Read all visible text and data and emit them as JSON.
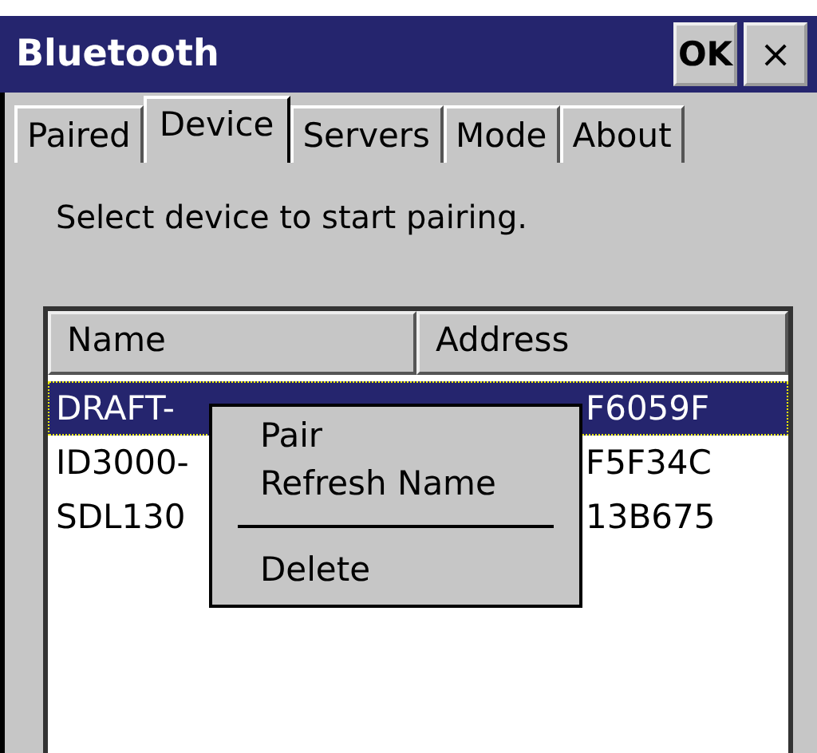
{
  "window": {
    "title": "Bluetooth",
    "ok_button": "OK",
    "close_button": "×"
  },
  "tabs": [
    {
      "label": "Paired",
      "selected": false
    },
    {
      "label": "Device",
      "selected": true
    },
    {
      "label": "Servers",
      "selected": false
    },
    {
      "label": "Mode",
      "selected": false
    },
    {
      "label": "About",
      "selected": false
    }
  ],
  "instruction": "Select device to start pairing.",
  "table": {
    "columns": [
      "Name",
      "Address"
    ],
    "rows": [
      {
        "name": "DRAFT-",
        "address": "F6059F",
        "selected": true
      },
      {
        "name": "ID3000-",
        "address": "F5F34C",
        "selected": false
      },
      {
        "name": "SDL130",
        "address": "13B675",
        "selected": false
      }
    ]
  },
  "context_menu": [
    {
      "kind": "item",
      "label": "Pair"
    },
    {
      "kind": "item",
      "label": "Refresh Name"
    },
    {
      "kind": "separator"
    },
    {
      "kind": "item",
      "label": "Delete"
    }
  ]
}
